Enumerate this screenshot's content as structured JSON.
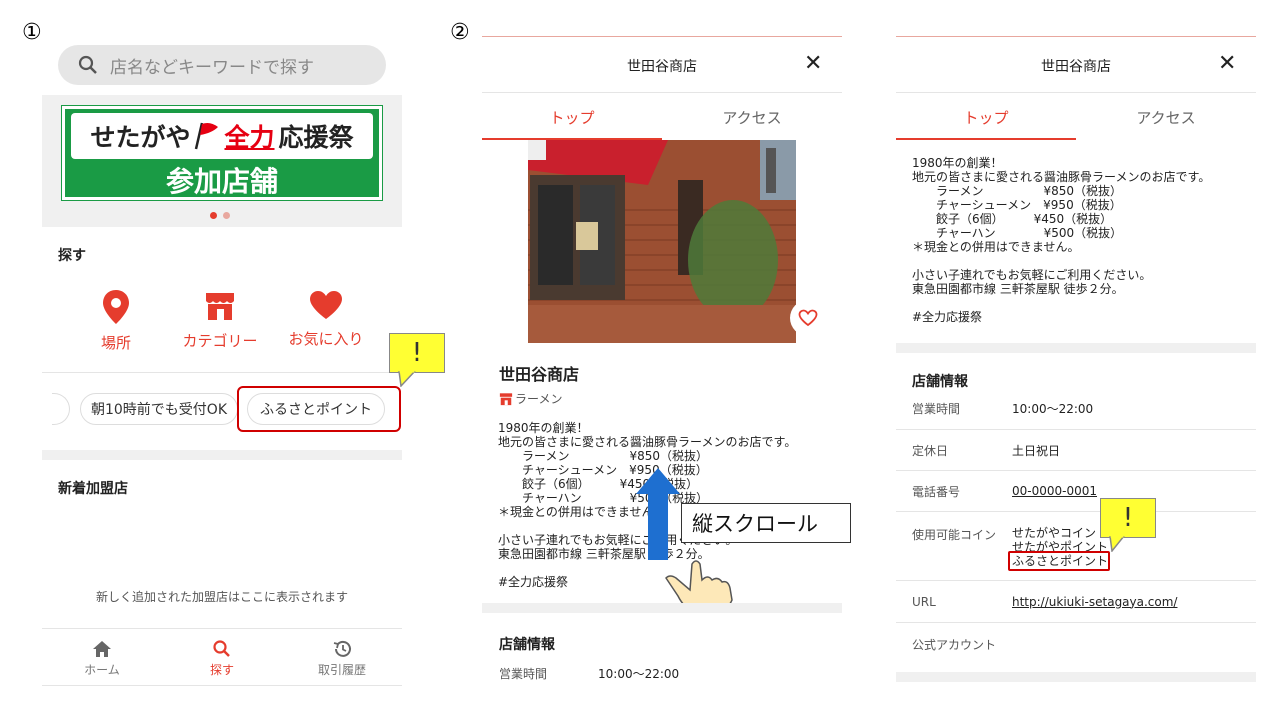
{
  "steps": {
    "one": "①",
    "two": "②"
  },
  "panel1": {
    "search_placeholder": "店名などキーワードで探す",
    "banner": {
      "line1_a": "せたがや",
      "line1_b": "全力",
      "line1_c": "応援祭",
      "line2": "参加店舗"
    },
    "find_title": "探す",
    "categories": [
      {
        "label": "場所",
        "icon": "location-pin-icon"
      },
      {
        "label": "カテゴリー",
        "icon": "store-icon"
      },
      {
        "label": "お気に入り",
        "icon": "heart-icon"
      }
    ],
    "chips": [
      "朝10時前でも受付OK",
      "ふるさとポイント"
    ],
    "new_title": "新着加盟店",
    "new_empty": "新しく追加された加盟店はここに表示されます",
    "nav": [
      {
        "label": "ホーム",
        "icon": "home-icon"
      },
      {
        "label": "探す",
        "icon": "search-icon"
      },
      {
        "label": "取引履歴",
        "icon": "history-icon"
      }
    ],
    "callout_mark": "!"
  },
  "panel2": {
    "title": "世田谷商店",
    "close": "✕",
    "tabs": [
      "トップ",
      "アクセス"
    ],
    "shop_name": "世田谷商店",
    "category": "ラーメン",
    "description": "1980年の創業！\n地元の皆さまに愛される醤油豚骨ラーメンのお店です。\n　　ラーメン　　　　　¥850（税抜）\n　　チャーシューメン　¥950（税抜）\n　　餃子（6個）　　　¥450（税抜）\n　　チャーハン　　　　¥500（税抜）\n＊現金との併用はできません。\n\n小さい子連れでもお気軽にご利用ください。\n東急田園都市線 三軒茶屋駅 徒歩２分。\n\n#全力応援祭",
    "scroll_label": "縦スクロール",
    "info_title": "店舗情報",
    "hours_label": "営業時間",
    "hours_value": "10:00〜22:00"
  },
  "panel3": {
    "title": "世田谷商店",
    "close": "✕",
    "tabs": [
      "トップ",
      "アクセス"
    ],
    "description": "1980年の創業！\n地元の皆さまに愛される醤油豚骨ラーメンのお店です。\n　　ラーメン　　　　　¥850（税抜）\n　　チャーシューメン　¥950（税抜）\n　　餃子（6個）　　　¥450（税抜）\n　　チャーハン　　　　¥500（税抜）\n＊現金との併用はできません。\n\n小さい子連れでもお気軽にご利用ください。\n東急田園都市線 三軒茶屋駅 徒歩２分。\n\n#全力応援祭",
    "info_title": "店舗情報",
    "rows": [
      {
        "label": "営業時間",
        "value": "10:00〜22:00"
      },
      {
        "label": "定休日",
        "value": "土日祝日"
      },
      {
        "label": "電話番号",
        "value": "00-0000-0001"
      },
      {
        "label": "使用可能コイン",
        "value1": "せたがやコイン",
        "value2": "せたがやポイント",
        "value3": "ふるさとポイント"
      },
      {
        "label": "URL",
        "value": "http://ukiuki-setagaya.com/"
      },
      {
        "label": "公式アカウント",
        "value": ""
      }
    ],
    "callout_mark": "!"
  },
  "colors": {
    "accent": "#e53c2d",
    "banner_green": "#1a9b45",
    "callout_yellow": "#ffff33",
    "highlight": "#d00000"
  }
}
